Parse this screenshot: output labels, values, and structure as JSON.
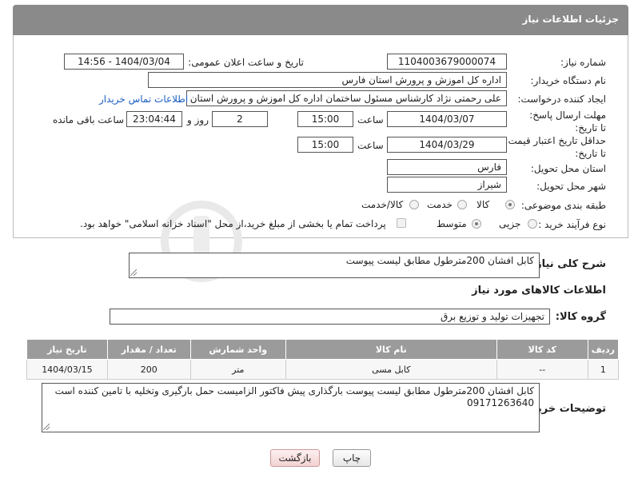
{
  "header": {
    "title": "جزئیات اطلاعات نیاز"
  },
  "fields": {
    "need_number": {
      "label": "شماره نیاز:",
      "value": "1104003679000074"
    },
    "announce_datetime": {
      "label": "تاریخ و ساعت اعلان عمومی:",
      "value": "1404/03/04 - 14:56"
    },
    "buyer_org": {
      "label": "نام دستگاه خریدار:",
      "value": "اداره کل اموزش و پرورش استان فارس"
    },
    "requester": {
      "label": "ایجاد کننده درخواست:",
      "value": "علی رحمتی نژاد کارشناس مسئول ساختمان اداره کل اموزش و پرورش استان فارس",
      "contact_link": "اطلاعات تماس خریدار"
    },
    "deadline": {
      "label": "مهلت ارسال پاسخ: تا تاریخ:",
      "date": "1404/03/07",
      "time_label": "ساعت",
      "time": "15:00",
      "days": "2",
      "days_label": "روز و",
      "remaining": "23:04:44",
      "remaining_label": "ساعت باقی مانده"
    },
    "price_validity": {
      "label": "حداقل تاریخ اعتبار قیمت: تا تاریخ:",
      "date": "1404/03/29",
      "time_label": "ساعت",
      "time": "15:00"
    },
    "delivery_province": {
      "label": "استان محل تحویل:",
      "value": "فارس"
    },
    "delivery_city": {
      "label": "شهر محل تحویل:",
      "value": "شیراز"
    },
    "category": {
      "label": "طبقه بندی موضوعی:",
      "options": [
        "کالا",
        "خدمت",
        "کالا/خدمت"
      ],
      "selected": "کالا"
    },
    "purchase_type": {
      "label": "نوع فرآیند خرید :",
      "options": [
        "جزیی",
        "متوسط"
      ],
      "selected": "متوسط",
      "payment_note": "پرداخت تمام یا بخشی از مبلغ خرید،از محل \"اسناد خزانه اسلامی\" خواهد بود."
    }
  },
  "description": {
    "label": "شرح کلی نیاز:",
    "value": "کابل افشان 200مترطول مطابق لیست پیوست"
  },
  "goods_info": {
    "title": "اطلاعات کالاهای مورد نیاز",
    "group_label": "گروه کالا:",
    "group_value": "تجهیزات تولید و توزیع برق"
  },
  "table": {
    "headers": [
      "ردیف",
      "کد کالا",
      "نام کالا",
      "واحد شمارش",
      "تعداد / مقدار",
      "تاریخ نیاز"
    ],
    "rows": [
      [
        "1",
        "--",
        "کابل مسی",
        "متر",
        "200",
        "1404/03/15"
      ]
    ]
  },
  "buyer_notes": {
    "label": "توضیحات خریدار:",
    "value": "کابل افشان 200مترطول مطابق لیست پیوست بارگذاری پیش فاکتور الزامیست حمل بارگیری وتخلیه با تامین کننده است 09171263640"
  },
  "buttons": {
    "print": "چاپ",
    "back": "بازگشت"
  },
  "colors": {
    "header_bg": "#8a8a8a",
    "table_header_bg": "#9b9b9b",
    "link": "#1a5fc2",
    "back_button": "#f2d2d2"
  }
}
